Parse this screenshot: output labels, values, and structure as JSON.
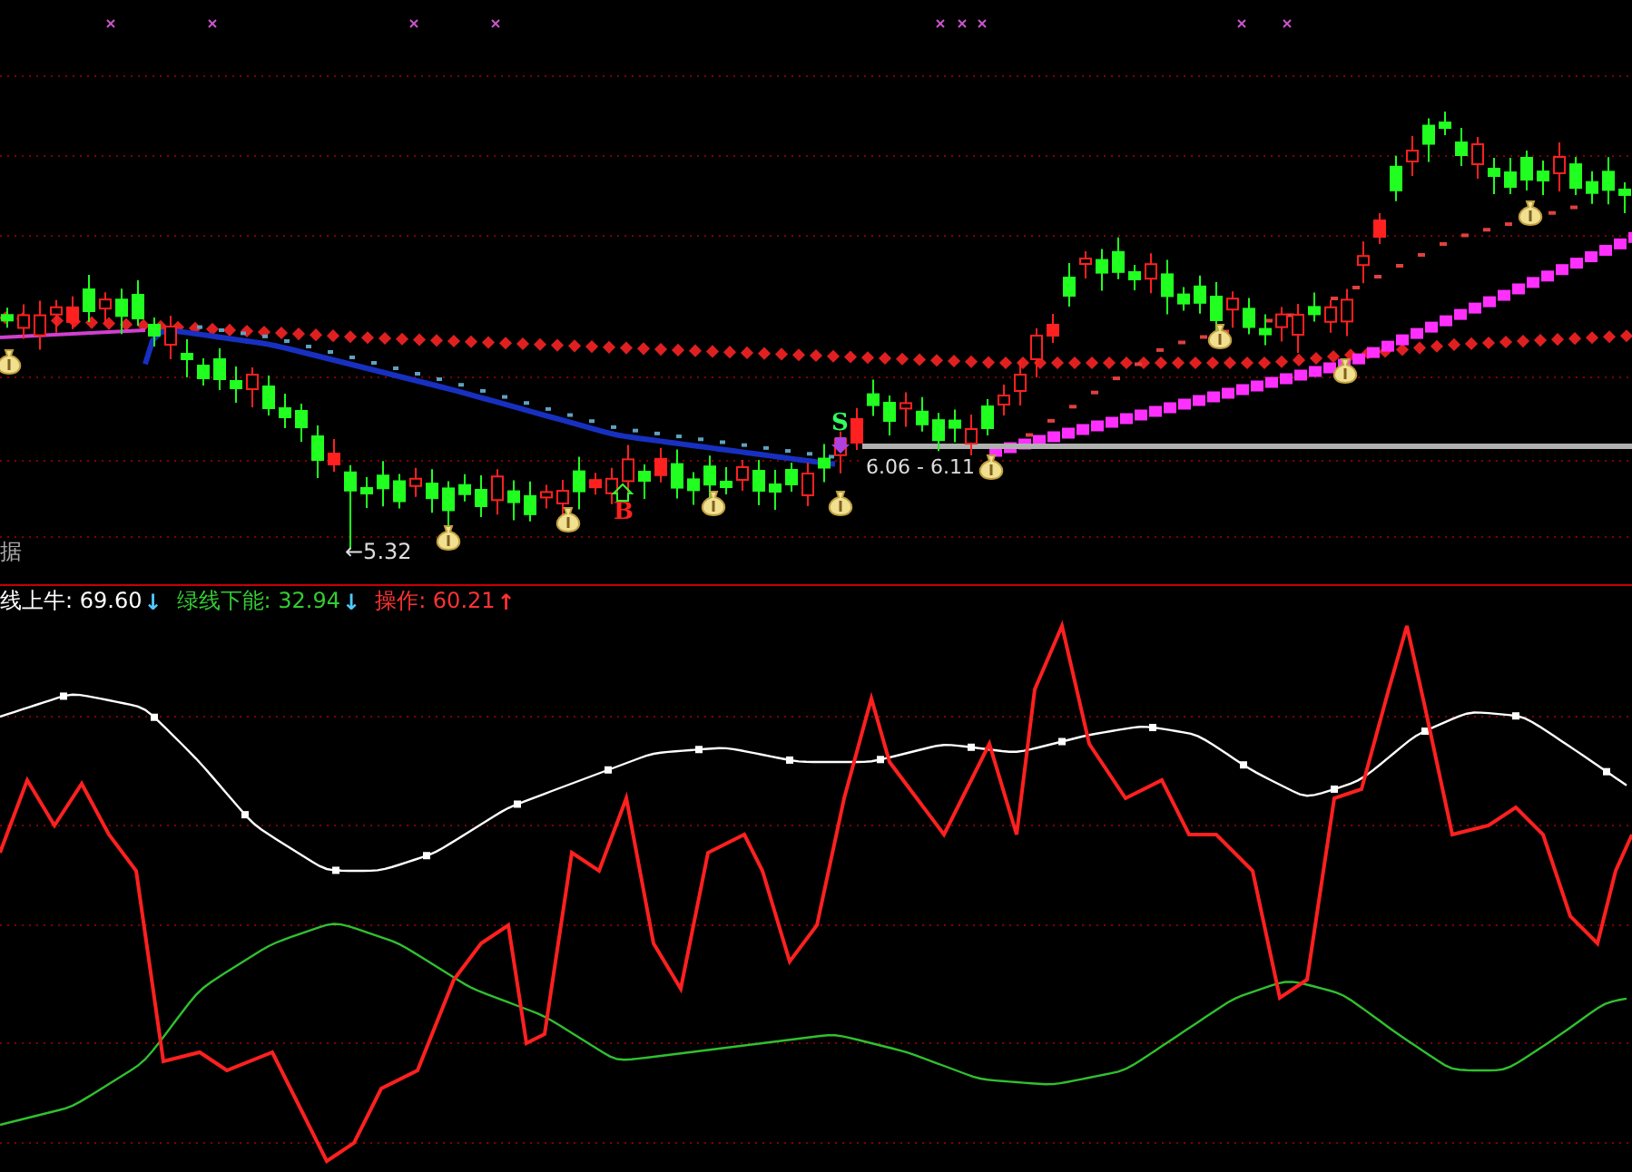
{
  "main_panel": {
    "side_label": "据",
    "low_marker": "←5.32",
    "range_label": "6.06 - 6.11",
    "signals": [
      {
        "text": "S",
        "kind": "sell"
      },
      {
        "text": "B",
        "kind": "buy"
      }
    ]
  },
  "legend": [
    {
      "text": "线上牛: 69.60",
      "color": "#ffffff",
      "arrow": {
        "text": "↓",
        "color": "#50c8ff"
      }
    },
    {
      "text": "绿线下能: 32.94",
      "color": "#33cc33",
      "arrow": {
        "text": "↓",
        "color": "#50c8ff"
      }
    },
    {
      "text": "操作: 60.21",
      "color": "#ff3333",
      "arrow": {
        "text": "↑",
        "color": "#ff3030"
      }
    }
  ]
}
